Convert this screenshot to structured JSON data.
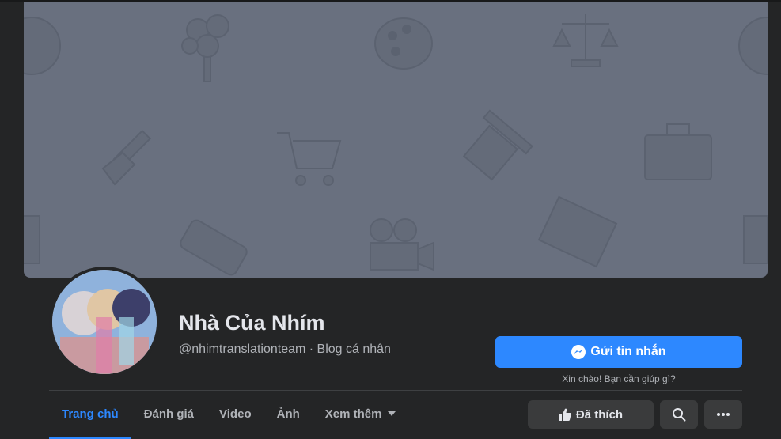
{
  "page": {
    "name": "Nhà Của Nhím",
    "subtitle": "@nhimtranslationteam · Blog cá nhân"
  },
  "actions": {
    "message_label": "Gửi tin nhắn",
    "greeting": "Xin chào! Bạn cần giúp gì?",
    "like_label": "Đã thích"
  },
  "tabs": [
    {
      "label": "Trang chủ",
      "active": true
    },
    {
      "label": "Đánh giá",
      "active": false
    },
    {
      "label": "Video",
      "active": false
    },
    {
      "label": "Ảnh",
      "active": false
    },
    {
      "label": "Xem thêm",
      "active": false
    }
  ],
  "icons": {
    "message": "messenger-icon",
    "like": "thumbs-up-icon",
    "search": "search-icon",
    "more": "more-icon",
    "dropdown": "caret-down-icon"
  },
  "colors": {
    "background": "#242526",
    "cover": "#69707f",
    "accent": "#2d88ff",
    "button_gray": "#3a3b3c",
    "text_primary": "#e4e6eb",
    "text_secondary": "#b0b3b8"
  }
}
